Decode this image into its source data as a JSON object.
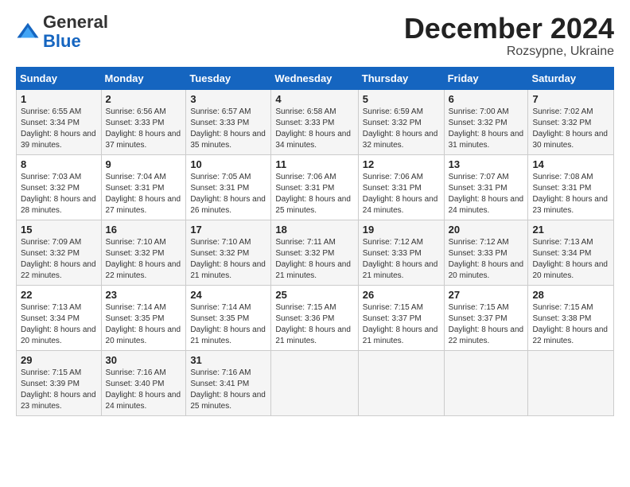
{
  "logo": {
    "general": "General",
    "blue": "Blue"
  },
  "header": {
    "month": "December 2024",
    "location": "Rozsypne, Ukraine"
  },
  "weekdays": [
    "Sunday",
    "Monday",
    "Tuesday",
    "Wednesday",
    "Thursday",
    "Friday",
    "Saturday"
  ],
  "weeks": [
    [
      {
        "day": "1",
        "sunrise": "6:55 AM",
        "sunset": "3:34 PM",
        "daylight": "8 hours and 39 minutes."
      },
      {
        "day": "2",
        "sunrise": "6:56 AM",
        "sunset": "3:33 PM",
        "daylight": "8 hours and 37 minutes."
      },
      {
        "day": "3",
        "sunrise": "6:57 AM",
        "sunset": "3:33 PM",
        "daylight": "8 hours and 35 minutes."
      },
      {
        "day": "4",
        "sunrise": "6:58 AM",
        "sunset": "3:33 PM",
        "daylight": "8 hours and 34 minutes."
      },
      {
        "day": "5",
        "sunrise": "6:59 AM",
        "sunset": "3:32 PM",
        "daylight": "8 hours and 32 minutes."
      },
      {
        "day": "6",
        "sunrise": "7:00 AM",
        "sunset": "3:32 PM",
        "daylight": "8 hours and 31 minutes."
      },
      {
        "day": "7",
        "sunrise": "7:02 AM",
        "sunset": "3:32 PM",
        "daylight": "8 hours and 30 minutes."
      }
    ],
    [
      {
        "day": "8",
        "sunrise": "7:03 AM",
        "sunset": "3:32 PM",
        "daylight": "8 hours and 28 minutes."
      },
      {
        "day": "9",
        "sunrise": "7:04 AM",
        "sunset": "3:31 PM",
        "daylight": "8 hours and 27 minutes."
      },
      {
        "day": "10",
        "sunrise": "7:05 AM",
        "sunset": "3:31 PM",
        "daylight": "8 hours and 26 minutes."
      },
      {
        "day": "11",
        "sunrise": "7:06 AM",
        "sunset": "3:31 PM",
        "daylight": "8 hours and 25 minutes."
      },
      {
        "day": "12",
        "sunrise": "7:06 AM",
        "sunset": "3:31 PM",
        "daylight": "8 hours and 24 minutes."
      },
      {
        "day": "13",
        "sunrise": "7:07 AM",
        "sunset": "3:31 PM",
        "daylight": "8 hours and 24 minutes."
      },
      {
        "day": "14",
        "sunrise": "7:08 AM",
        "sunset": "3:31 PM",
        "daylight": "8 hours and 23 minutes."
      }
    ],
    [
      {
        "day": "15",
        "sunrise": "7:09 AM",
        "sunset": "3:32 PM",
        "daylight": "8 hours and 22 minutes."
      },
      {
        "day": "16",
        "sunrise": "7:10 AM",
        "sunset": "3:32 PM",
        "daylight": "8 hours and 22 minutes."
      },
      {
        "day": "17",
        "sunrise": "7:10 AM",
        "sunset": "3:32 PM",
        "daylight": "8 hours and 21 minutes."
      },
      {
        "day": "18",
        "sunrise": "7:11 AM",
        "sunset": "3:32 PM",
        "daylight": "8 hours and 21 minutes."
      },
      {
        "day": "19",
        "sunrise": "7:12 AM",
        "sunset": "3:33 PM",
        "daylight": "8 hours and 21 minutes."
      },
      {
        "day": "20",
        "sunrise": "7:12 AM",
        "sunset": "3:33 PM",
        "daylight": "8 hours and 20 minutes."
      },
      {
        "day": "21",
        "sunrise": "7:13 AM",
        "sunset": "3:34 PM",
        "daylight": "8 hours and 20 minutes."
      }
    ],
    [
      {
        "day": "22",
        "sunrise": "7:13 AM",
        "sunset": "3:34 PM",
        "daylight": "8 hours and 20 minutes."
      },
      {
        "day": "23",
        "sunrise": "7:14 AM",
        "sunset": "3:35 PM",
        "daylight": "8 hours and 20 minutes."
      },
      {
        "day": "24",
        "sunrise": "7:14 AM",
        "sunset": "3:35 PM",
        "daylight": "8 hours and 21 minutes."
      },
      {
        "day": "25",
        "sunrise": "7:15 AM",
        "sunset": "3:36 PM",
        "daylight": "8 hours and 21 minutes."
      },
      {
        "day": "26",
        "sunrise": "7:15 AM",
        "sunset": "3:37 PM",
        "daylight": "8 hours and 21 minutes."
      },
      {
        "day": "27",
        "sunrise": "7:15 AM",
        "sunset": "3:37 PM",
        "daylight": "8 hours and 22 minutes."
      },
      {
        "day": "28",
        "sunrise": "7:15 AM",
        "sunset": "3:38 PM",
        "daylight": "8 hours and 22 minutes."
      }
    ],
    [
      {
        "day": "29",
        "sunrise": "7:15 AM",
        "sunset": "3:39 PM",
        "daylight": "8 hours and 23 minutes."
      },
      {
        "day": "30",
        "sunrise": "7:16 AM",
        "sunset": "3:40 PM",
        "daylight": "8 hours and 24 minutes."
      },
      {
        "day": "31",
        "sunrise": "7:16 AM",
        "sunset": "3:41 PM",
        "daylight": "8 hours and 25 minutes."
      },
      null,
      null,
      null,
      null
    ]
  ]
}
